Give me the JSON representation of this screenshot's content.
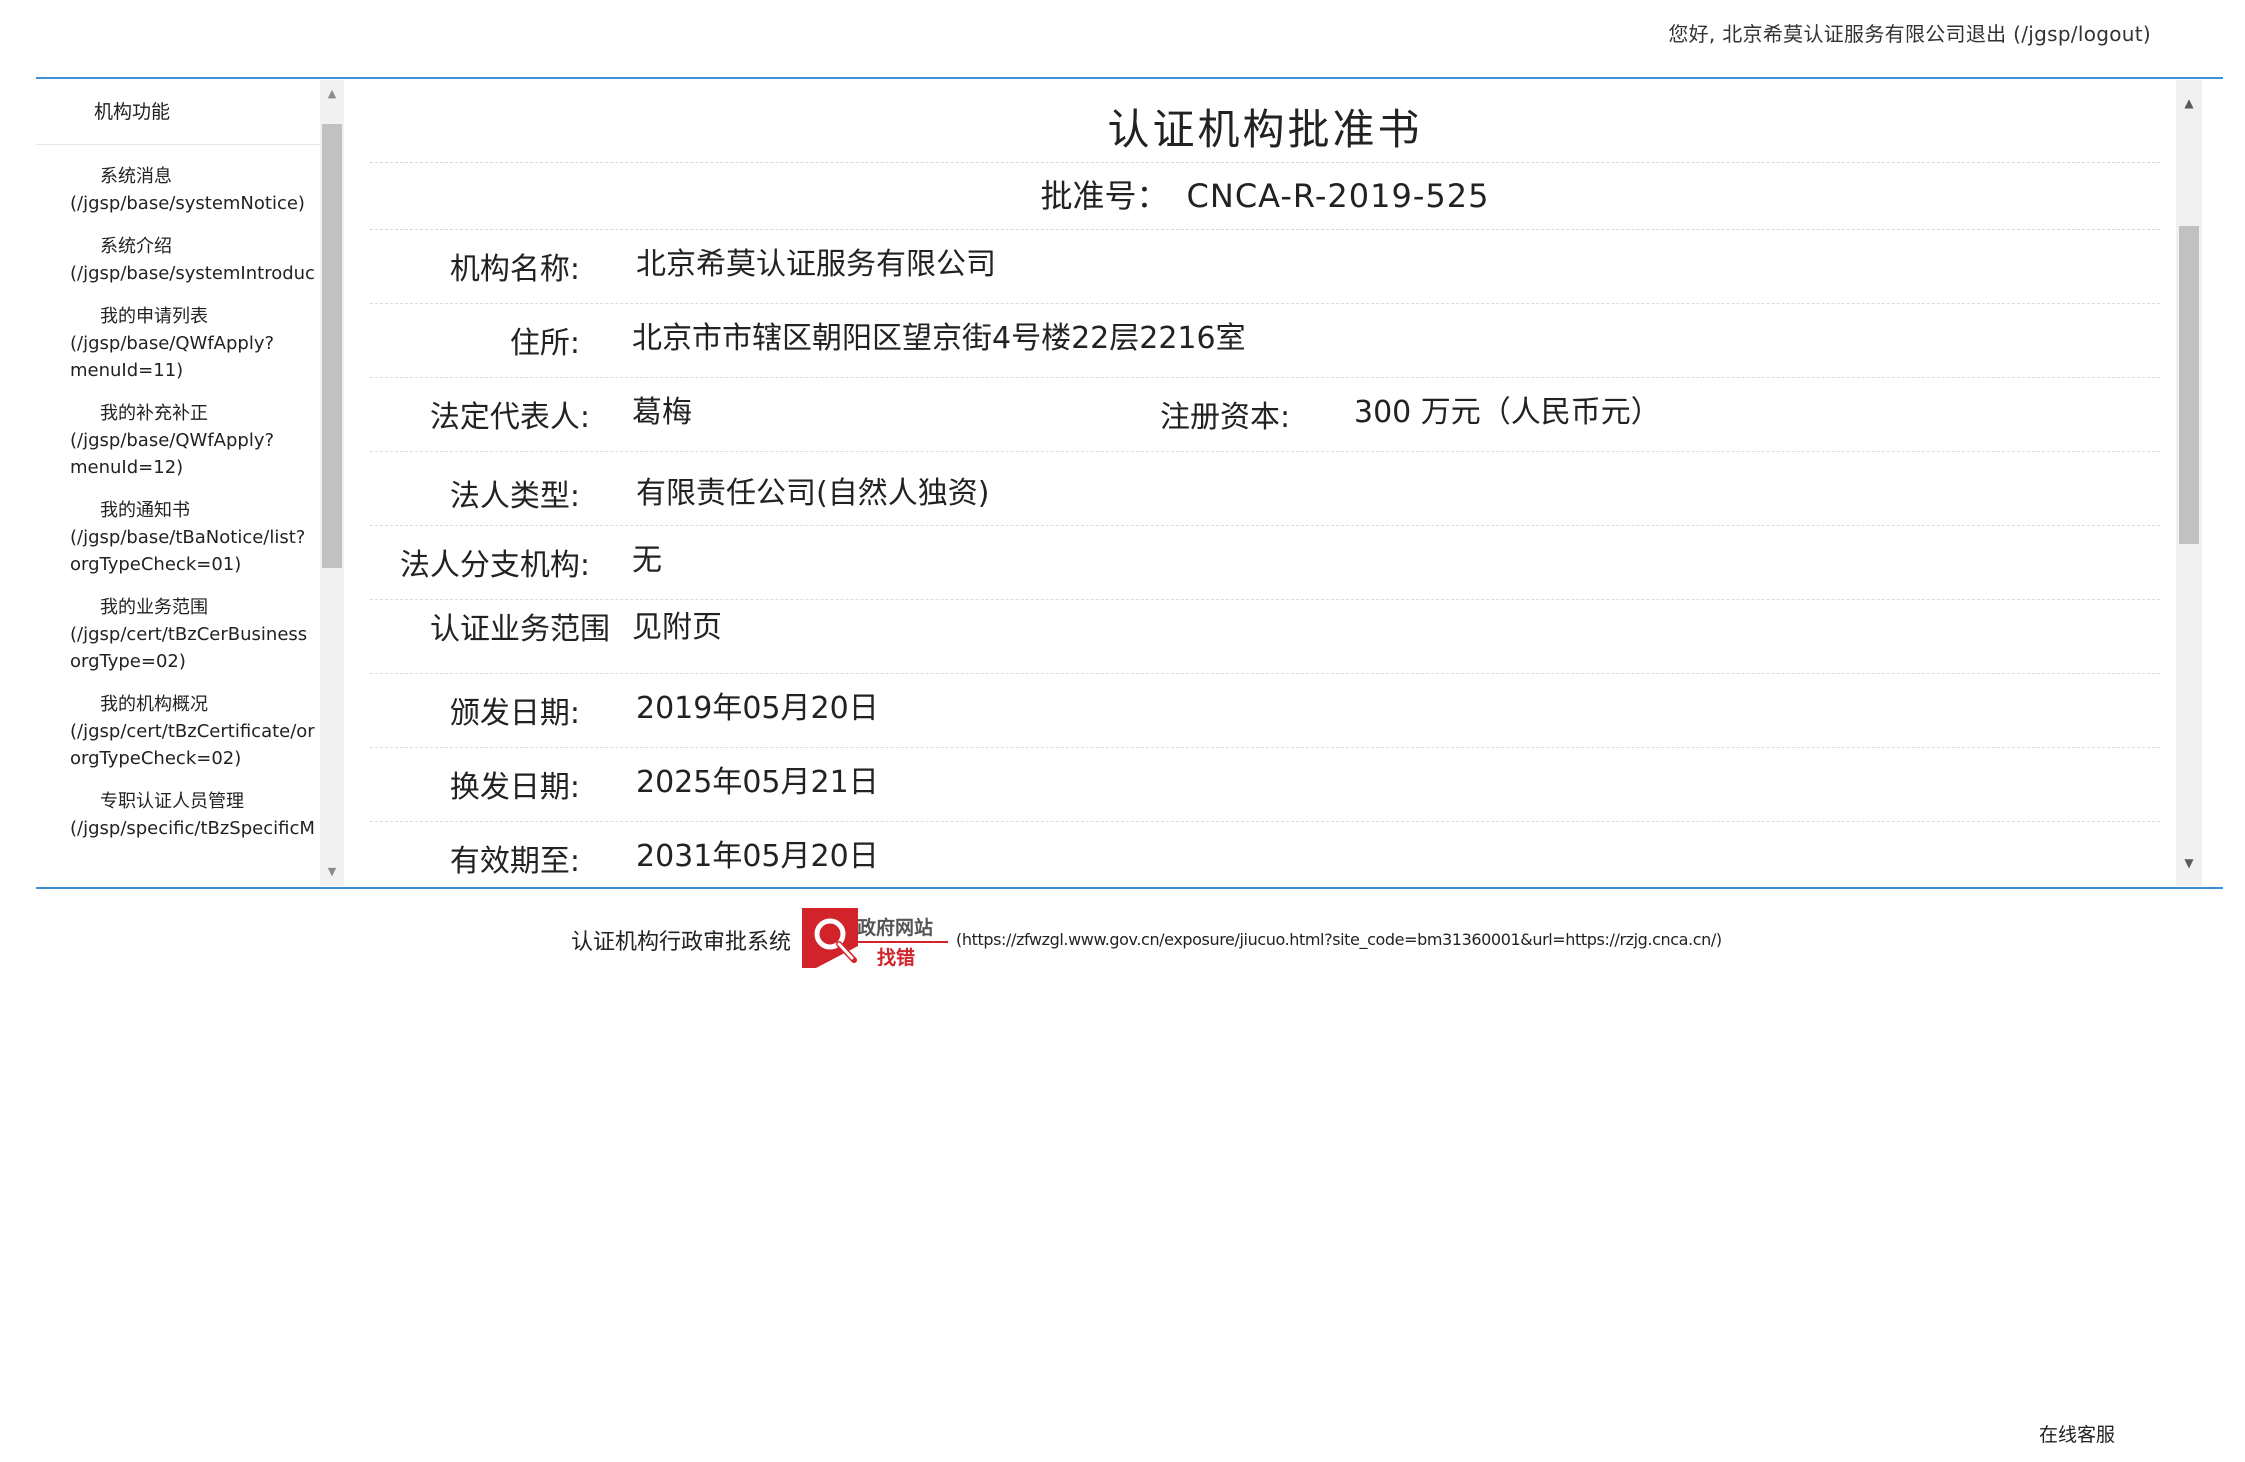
{
  "header": {
    "greeting": "您好, 北京希莫认证服务有限公司退出 (/jgsp/logout)"
  },
  "sidebar": {
    "title": "机构功能",
    "items": [
      {
        "label": "系统消息",
        "url": "(/jgsp/base/systemNotice)"
      },
      {
        "label": "系统介绍",
        "url": "(/jgsp/base/systemIntroduc"
      },
      {
        "label": "我的申请列表",
        "url": "(/jgsp/base/QWfApply?\nmenuId=11)"
      },
      {
        "label": "我的补充补正",
        "url": "(/jgsp/base/QWfApply?\nmenuId=12)"
      },
      {
        "label": "我的通知书",
        "url": "(/jgsp/base/tBaNotice/list?\norgTypeCheck=01)"
      },
      {
        "label": "我的业务范围",
        "url": "(/jgsp/cert/tBzCerBusiness\norgType=02)"
      },
      {
        "label": "我的机构概况",
        "url": "(/jgsp/cert/tBzCertificate/or\norgTypeCheck=02)"
      },
      {
        "label": "专职认证人员管理",
        "url": "(/jgsp/specific/tBzSpecificM"
      }
    ]
  },
  "certificate": {
    "title": "认证机构批准书",
    "number_label": "批准号：",
    "number_value": "CNCA-R-2019-525",
    "org_name_label": "机构名称:",
    "org_name": "北京希莫认证服务有限公司",
    "address_label": "住所:",
    "address": "北京市市辖区朝阳区望京街4号楼22层2216室",
    "legal_rep_label": "法定代表人:",
    "legal_rep": "葛梅",
    "capital_label": "注册资本:",
    "capital": "300 万元（人民币元）",
    "legal_type_label": "法人类型:",
    "legal_type": "有限责任公司(自然人独资)",
    "branch_label": "法人分支机构:",
    "branch": "无",
    "scope_label": "认证业务范围",
    "scope": "见附页",
    "issue_date_label": "颁发日期:",
    "issue_date": "2019年05月20日",
    "reissue_date_label": "换发日期:",
    "reissue_date": "2025年05月21日",
    "valid_until_label": "有效期至:",
    "valid_until": "2031年05月20日"
  },
  "footer": {
    "system_name": "认证机构行政审批系统",
    "logo_text_top": "政府网站",
    "logo_text_bottom": "找错",
    "link": "(https://zfwzgl.www.gov.cn/exposure/jiucuo.html?site_code=bm31360001&url=https://rzjg.cnca.cn/)",
    "service": "在线客服"
  },
  "colors": {
    "accent_line": "#3d8fd6",
    "gov_logo_red": "#d2232a"
  }
}
